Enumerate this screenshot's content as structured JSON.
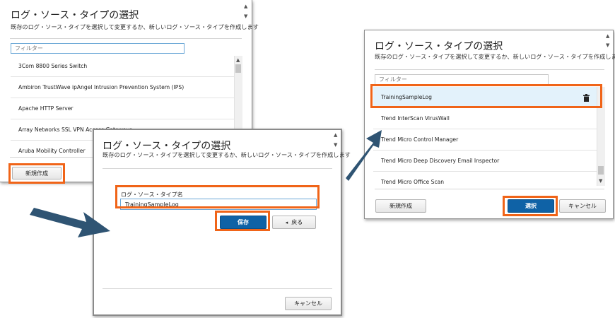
{
  "dialog_common": {
    "title": "ログ・ソース・タイプの選択",
    "subtitle": "既存のログ・ソース・タイプを選択して変更するか、新しいログ・ソース・タイプを作成します"
  },
  "dialog1": {
    "filter_placeholder": "フィルター",
    "items": [
      {
        "label": "3Com 8800 Series Switch"
      },
      {
        "label": "Ambiron TrustWave ipAngel Intrusion Prevention System (IPS)"
      },
      {
        "label": "Apache HTTP Server"
      },
      {
        "label": "Array Networks SSL VPN Access Gateways"
      },
      {
        "label": "Aruba Mobility Controller"
      }
    ],
    "new_button": "新規作成"
  },
  "dialog2": {
    "field_label": "ログ・ソース・タイプ名",
    "field_value": "TrainingSampleLog",
    "save_button": "保存",
    "back_button": "戻る",
    "back_icon": "chevron-left-icon",
    "cancel_button": "キャンセル"
  },
  "dialog3": {
    "filter_placeholder": "フィルター",
    "items": [
      {
        "label": "TrainingSampleLog"
      },
      {
        "label": "Trend InterScan VirusWall"
      },
      {
        "label": "Trend Micro Control Manager"
      },
      {
        "label": "Trend Micro Deep Discovery Email Inspector"
      },
      {
        "label": "Trend Micro Office Scan"
      }
    ],
    "delete_icon": "trash-icon",
    "new_button": "新規作成",
    "select_button": "選択",
    "cancel_button": "キャンセル"
  },
  "colors": {
    "highlight": "#f06418",
    "arrow": "#2f5473",
    "primary_button": "#0f62a6",
    "selected_row": "#e3f2fb",
    "filter_border_active": "#6aa7d6"
  }
}
